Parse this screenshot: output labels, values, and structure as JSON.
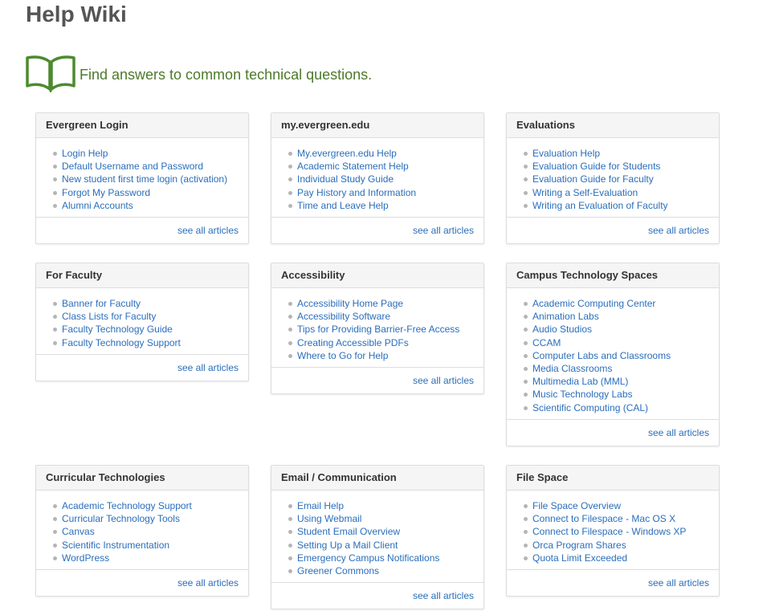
{
  "page": {
    "title": "Help Wiki",
    "tagline": "Find answers to common technical questions.",
    "accent_color": "#4d7a2a",
    "link_color": "#2a6ebb"
  },
  "panels": [
    {
      "heading": "Evergreen Login",
      "links": [
        "Login Help",
        "Default Username and Password",
        "New student first time login (activation)",
        "Forgot My Password",
        "Alumni Accounts"
      ],
      "footer": "see all articles"
    },
    {
      "heading": "my.evergreen.edu",
      "links": [
        "My.evergreen.edu Help",
        "Academic Statement Help",
        "Individual Study Guide",
        "Pay History and Information",
        "Time and Leave Help"
      ],
      "footer": "see all articles"
    },
    {
      "heading": "Evaluations",
      "links": [
        "Evaluation Help",
        "Evaluation Guide for Students",
        "Evaluation Guide for Faculty",
        "Writing a Self-Evaluation",
        "Writing an Evaluation of Faculty"
      ],
      "footer": "see all articles"
    },
    {
      "heading": "For Faculty",
      "links": [
        "Banner for Faculty",
        "Class Lists for Faculty",
        "Faculty Technology Guide",
        "Faculty Technology Support"
      ],
      "footer": "see all articles"
    },
    {
      "heading": "Accessibility",
      "links": [
        "Accessibility Home Page",
        "Accessibility Software",
        "Tips for Providing Barrier-Free Access",
        "Creating Accessible PDFs",
        "Where to Go for Help"
      ],
      "footer": "see all articles"
    },
    {
      "heading": "Campus Technology Spaces",
      "links": [
        "Academic Computing Center",
        "Animation Labs",
        "Audio Studios",
        "CCAM",
        "Computer Labs and Classrooms",
        "Media Classrooms",
        "Multimedia Lab (MML)",
        "Music Technology Labs",
        "Scientific Computing (CAL)"
      ],
      "footer": "see all articles"
    },
    {
      "heading": "Curricular Technologies",
      "links": [
        "Academic Technology Support",
        "Curricular Technology Tools",
        "Canvas",
        "Scientific Instrumentation",
        "WordPress"
      ],
      "footer": "see all articles"
    },
    {
      "heading": "Email / Communication",
      "links": [
        "Email Help",
        "Using Webmail",
        "Student Email Overview",
        "Setting Up a Mail Client",
        "Emergency Campus Notifications",
        "Greener Commons"
      ],
      "footer": "see all articles"
    },
    {
      "heading": "File Space",
      "links": [
        "File Space Overview",
        "Connect to Filespace - Mac OS X",
        "Connect to Filespace - Windows XP",
        "Orca Program Shares",
        "Quota Limit Exceeded"
      ],
      "footer": "see all articles"
    }
  ]
}
